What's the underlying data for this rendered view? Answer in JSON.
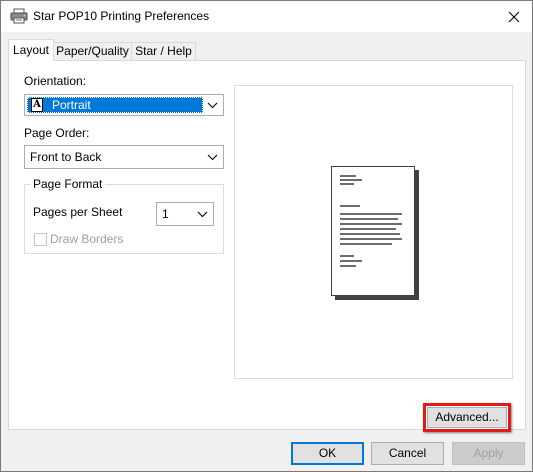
{
  "window": {
    "title": "Star POP10 Printing Preferences"
  },
  "tabs": [
    {
      "label": "Layout",
      "active": true
    },
    {
      "label": "Paper/Quality",
      "active": false
    },
    {
      "label": "Star / Help",
      "active": false
    }
  ],
  "layout": {
    "orientation": {
      "label": "Orientation:",
      "value": "Portrait"
    },
    "page_order": {
      "label": "Page Order:",
      "value": "Front to Back"
    },
    "page_format": {
      "title": "Page Format",
      "pages_per_sheet_label": "Pages per Sheet",
      "pages_per_sheet_value": "1",
      "draw_borders_label": "Draw Borders",
      "draw_borders_checked": false,
      "draw_borders_enabled": false
    },
    "advanced_label": "Advanced..."
  },
  "buttons": {
    "ok": "OK",
    "cancel": "Cancel",
    "apply": "Apply"
  },
  "colors": {
    "accent": "#0078d7",
    "highlight": "#e01919"
  }
}
